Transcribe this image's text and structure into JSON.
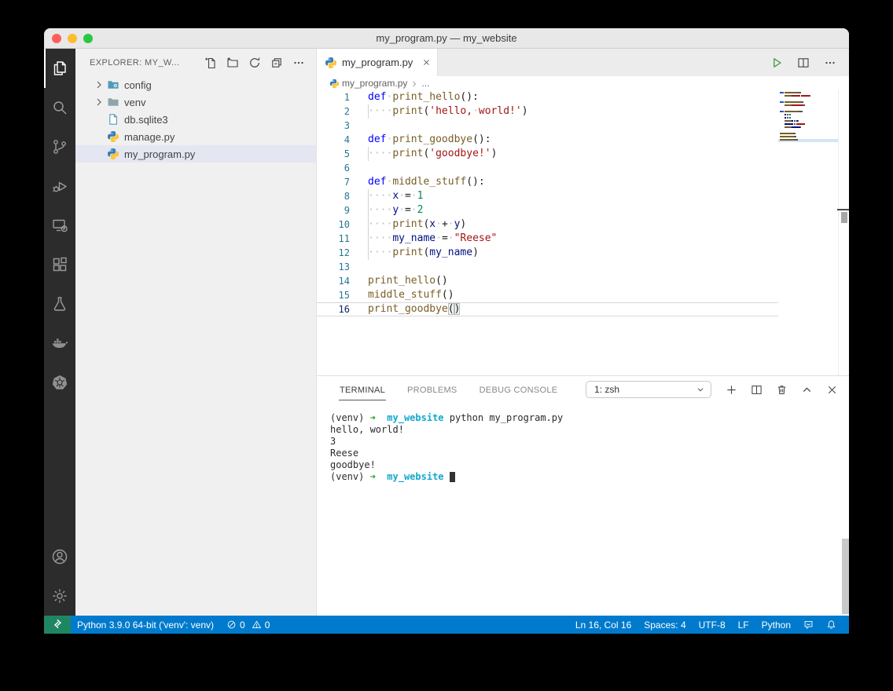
{
  "window": {
    "title": "my_program.py — my_website"
  },
  "colors": {
    "status_bar": "#007acc",
    "remote_indicator": "#1f8662",
    "activity_bar": "#2c2c2c",
    "selection": "#e4e6f1"
  },
  "activity_bar": {
    "items": [
      {
        "id": "explorer",
        "active": true
      },
      {
        "id": "search",
        "active": false
      },
      {
        "id": "source-control",
        "active": false
      },
      {
        "id": "run-debug",
        "active": false
      },
      {
        "id": "remote-explorer",
        "active": false
      },
      {
        "id": "extensions",
        "active": false
      },
      {
        "id": "testing",
        "active": false
      },
      {
        "id": "docker",
        "active": false
      },
      {
        "id": "kubernetes",
        "active": false
      }
    ],
    "bottom": [
      {
        "id": "account",
        "active": false
      },
      {
        "id": "settings",
        "active": false
      }
    ]
  },
  "explorer": {
    "title": "EXPLORER: MY_W...",
    "actions": [
      "new-file",
      "new-folder",
      "refresh",
      "collapse-all",
      "more"
    ],
    "files": [
      {
        "label": "config",
        "icon": "folder-config",
        "chevron": true,
        "selected": false
      },
      {
        "label": "venv",
        "icon": "folder",
        "chevron": true,
        "selected": false
      },
      {
        "label": "db.sqlite3",
        "icon": "file-db",
        "chevron": false,
        "selected": false
      },
      {
        "label": "manage.py",
        "icon": "python",
        "chevron": false,
        "selected": false
      },
      {
        "label": "my_program.py",
        "icon": "python",
        "chevron": false,
        "selected": true
      }
    ]
  },
  "editor": {
    "tab": {
      "label": "my_program.py"
    },
    "actions": [
      "run",
      "split-editor",
      "more"
    ],
    "breadcrumb": {
      "file": "my_program.py",
      "more": "..."
    },
    "code_lines": [
      {
        "n": "1",
        "g": false,
        "t": [
          [
            "kw",
            "def"
          ],
          [
            "ws",
            "·"
          ],
          [
            "fn",
            "print_hello"
          ],
          [
            "pun",
            "():"
          ]
        ]
      },
      {
        "n": "2",
        "g": true,
        "t": [
          [
            "ws",
            "····"
          ],
          [
            "fn",
            "print"
          ],
          [
            "pun",
            "("
          ],
          [
            "str",
            "'hello,"
          ],
          [
            "ws",
            "·"
          ],
          [
            "str",
            "world!'"
          ],
          [
            "pun",
            ")"
          ]
        ]
      },
      {
        "n": "3",
        "g": false,
        "t": []
      },
      {
        "n": "4",
        "g": false,
        "t": [
          [
            "kw",
            "def"
          ],
          [
            "ws",
            "·"
          ],
          [
            "fn",
            "print_goodbye"
          ],
          [
            "pun",
            "():"
          ]
        ]
      },
      {
        "n": "5",
        "g": true,
        "t": [
          [
            "ws",
            "····"
          ],
          [
            "fn",
            "print"
          ],
          [
            "pun",
            "("
          ],
          [
            "str",
            "'goodbye!'"
          ],
          [
            "pun",
            ")"
          ]
        ]
      },
      {
        "n": "6",
        "g": false,
        "t": []
      },
      {
        "n": "7",
        "g": false,
        "t": [
          [
            "kw",
            "def"
          ],
          [
            "ws",
            "·"
          ],
          [
            "fn",
            "middle_stuff"
          ],
          [
            "pun",
            "():"
          ]
        ]
      },
      {
        "n": "8",
        "g": true,
        "t": [
          [
            "ws",
            "····"
          ],
          [
            "var",
            "x"
          ],
          [
            "ws",
            "·"
          ],
          [
            "pun",
            "="
          ],
          [
            "ws",
            "·"
          ],
          [
            "num",
            "1"
          ]
        ]
      },
      {
        "n": "9",
        "g": true,
        "t": [
          [
            "ws",
            "····"
          ],
          [
            "var",
            "y"
          ],
          [
            "ws",
            "·"
          ],
          [
            "pun",
            "="
          ],
          [
            "ws",
            "·"
          ],
          [
            "num",
            "2"
          ]
        ]
      },
      {
        "n": "10",
        "g": true,
        "t": [
          [
            "ws",
            "····"
          ],
          [
            "fn",
            "print"
          ],
          [
            "pun",
            "("
          ],
          [
            "var",
            "x"
          ],
          [
            "ws",
            "·"
          ],
          [
            "pun",
            "+"
          ],
          [
            "ws",
            "·"
          ],
          [
            "var",
            "y"
          ],
          [
            "pun",
            ")"
          ]
        ]
      },
      {
        "n": "11",
        "g": true,
        "t": [
          [
            "ws",
            "····"
          ],
          [
            "var",
            "my_name"
          ],
          [
            "ws",
            "·"
          ],
          [
            "pun",
            "="
          ],
          [
            "ws",
            "·"
          ],
          [
            "str",
            "\"Reese\""
          ]
        ]
      },
      {
        "n": "12",
        "g": true,
        "t": [
          [
            "ws",
            "····"
          ],
          [
            "fn",
            "print"
          ],
          [
            "pun",
            "("
          ],
          [
            "var",
            "my_name"
          ],
          [
            "pun",
            ")"
          ]
        ]
      },
      {
        "n": "13",
        "g": false,
        "t": []
      },
      {
        "n": "14",
        "g": false,
        "t": [
          [
            "fn",
            "print_hello"
          ],
          [
            "pun",
            "()"
          ]
        ]
      },
      {
        "n": "15",
        "g": false,
        "t": [
          [
            "fn",
            "middle_stuff"
          ],
          [
            "pun",
            "()"
          ]
        ]
      },
      {
        "n": "16",
        "g": false,
        "cur": true,
        "t": [
          [
            "fn",
            "print_goodbye"
          ],
          [
            "bm",
            "("
          ],
          [
            "bm",
            ")"
          ]
        ]
      }
    ]
  },
  "panel": {
    "tabs": [
      {
        "label": "TERMINAL",
        "active": true
      },
      {
        "label": "PROBLEMS",
        "active": false
      },
      {
        "label": "DEBUG CONSOLE",
        "active": false
      }
    ],
    "shell_selector": {
      "value": "1: zsh"
    },
    "actions": [
      "new-terminal",
      "split-terminal",
      "kill-terminal",
      "maximize-panel",
      "close-panel"
    ],
    "terminal_lines": [
      {
        "t": [
          [
            "",
            "(venv) "
          ],
          [
            "green",
            "➜"
          ],
          [
            "",
            "  "
          ],
          [
            "cyan",
            "my_website"
          ],
          [
            "",
            " python my_program.py"
          ]
        ]
      },
      {
        "t": [
          [
            "",
            "hello, world!"
          ]
        ]
      },
      {
        "t": [
          [
            "",
            "3"
          ]
        ]
      },
      {
        "t": [
          [
            "",
            "Reese"
          ]
        ]
      },
      {
        "t": [
          [
            "",
            "goodbye!"
          ]
        ]
      },
      {
        "t": [
          [
            "",
            "(venv) "
          ],
          [
            "green",
            "➜"
          ],
          [
            "",
            "  "
          ],
          [
            "cyan",
            "my_website"
          ],
          [
            "",
            " "
          ],
          [
            "cursor",
            ""
          ]
        ]
      }
    ]
  },
  "status_bar": {
    "interpreter": "Python 3.9.0 64-bit ('venv': venv)",
    "errors": "0",
    "warnings": "0",
    "right_items": [
      "Ln 16, Col 16",
      "Spaces: 4",
      "UTF-8",
      "LF",
      "Python"
    ]
  }
}
